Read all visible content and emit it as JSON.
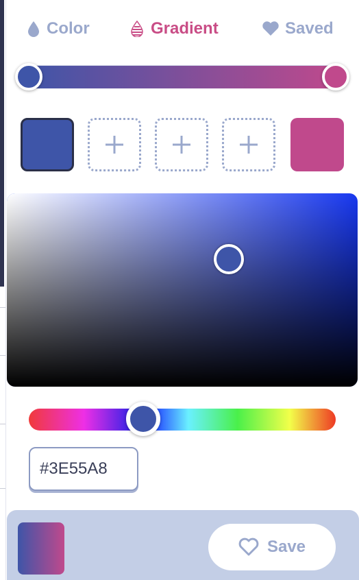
{
  "tabs": [
    {
      "label": "Color",
      "icon": "droplet-icon",
      "active": false
    },
    {
      "label": "Gradient",
      "icon": "gradient-icon",
      "active": true
    },
    {
      "label": "Saved",
      "icon": "heart-icon",
      "active": false
    }
  ],
  "gradient": {
    "start_color": "#3E55A8",
    "end_color": "#C0498C"
  },
  "swatches": [
    {
      "type": "color",
      "color": "#3E55A8",
      "selected": true
    },
    {
      "type": "empty",
      "icon": "plus-icon"
    },
    {
      "type": "empty",
      "icon": "plus-icon"
    },
    {
      "type": "empty",
      "icon": "plus-icon"
    },
    {
      "type": "color",
      "color": "#C0498C",
      "selected": false
    }
  ],
  "picker": {
    "hue_color": "#1838F0",
    "hex_value": "#3E55A8"
  },
  "footer": {
    "save_label": "Save",
    "save_icon": "heart-outline-icon"
  },
  "colors": {
    "accent": "#C94D86",
    "muted": "#9AA8CC",
    "footer_bg": "#C3CEE6"
  }
}
